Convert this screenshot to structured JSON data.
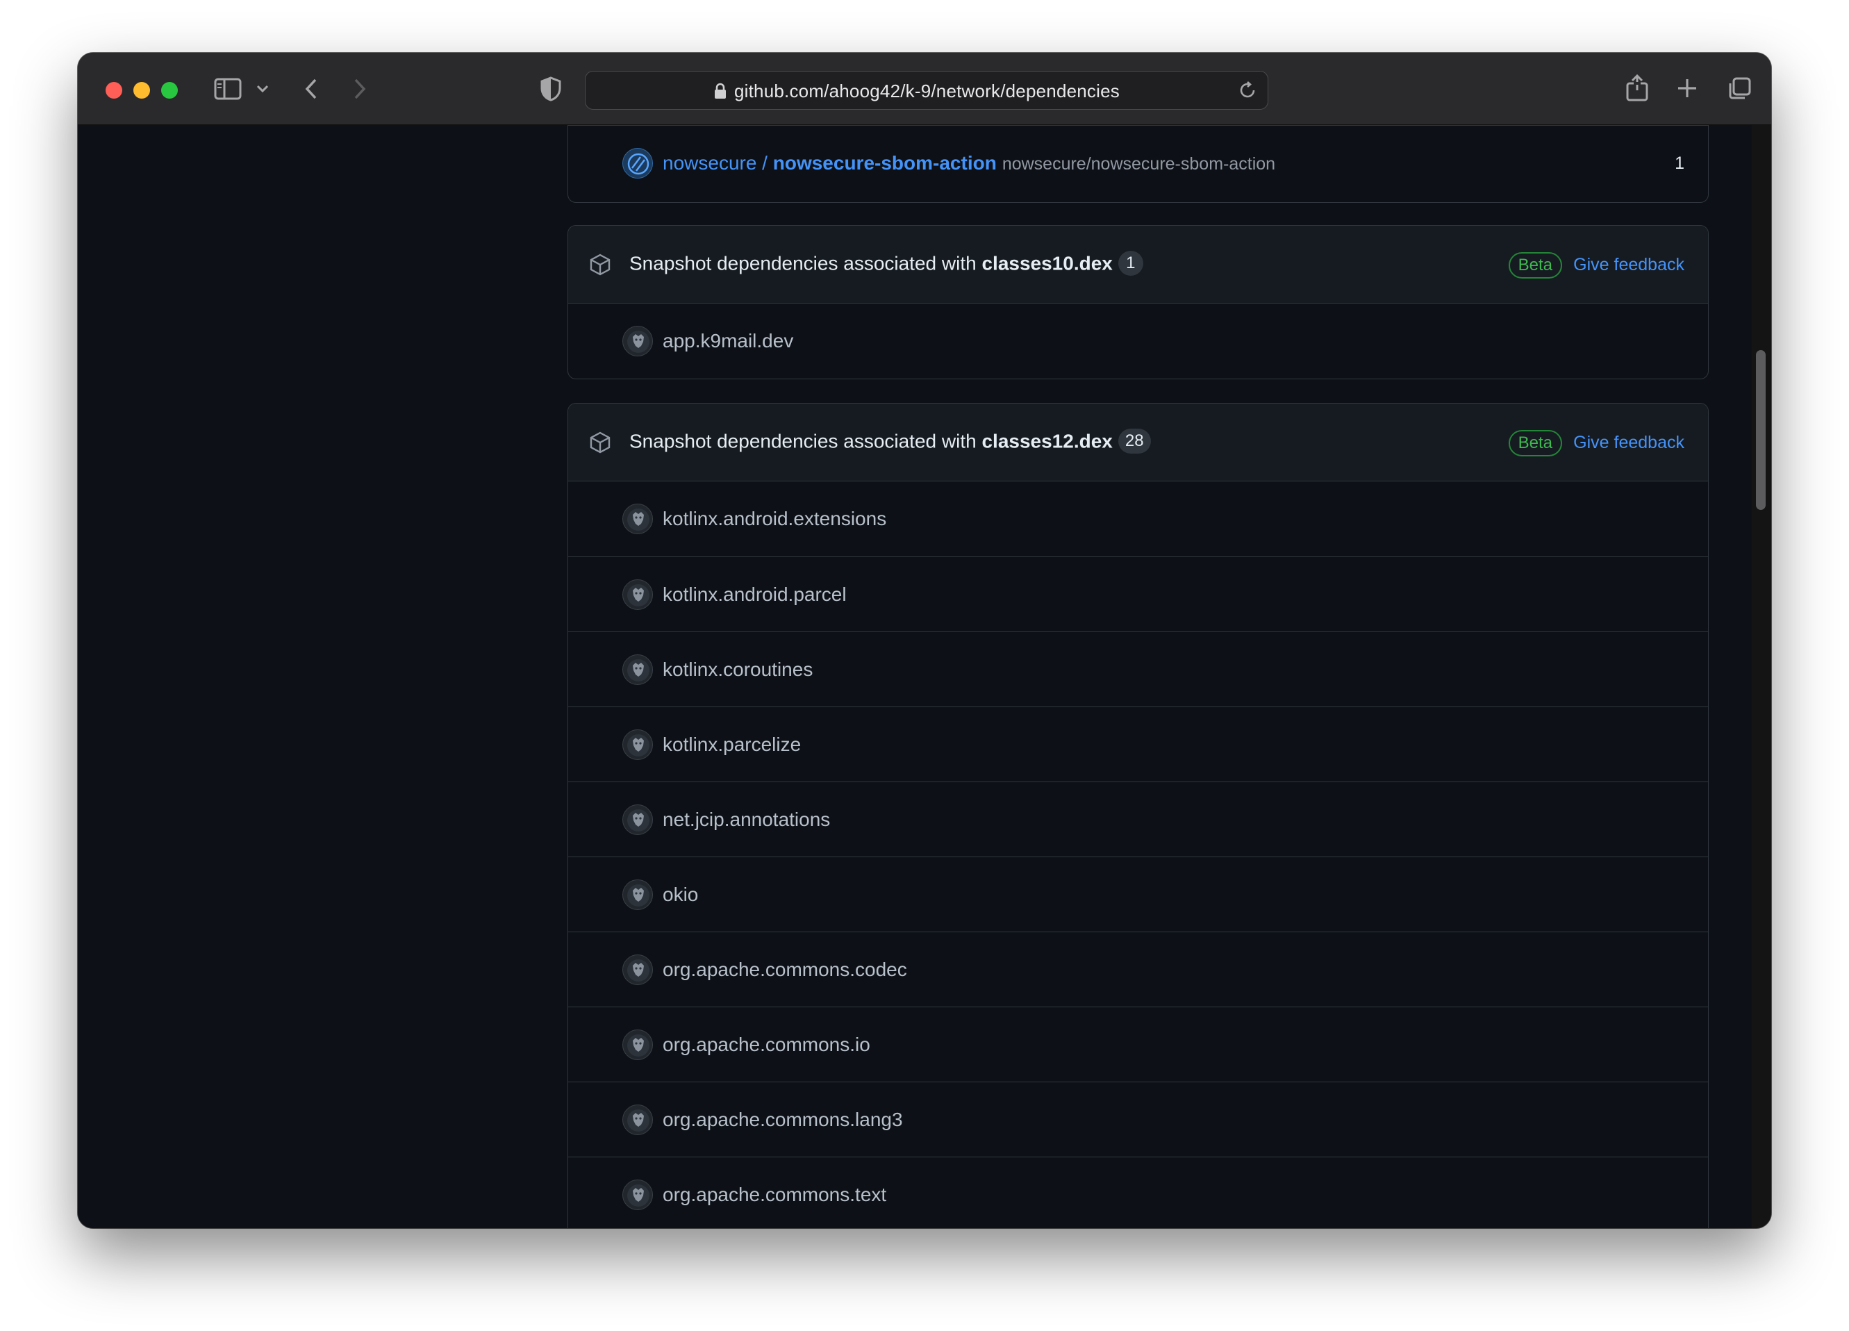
{
  "browser": {
    "url": "github.com/ahoog42/k-9/network/dependencies"
  },
  "top_box": {
    "owner": "nowsecure",
    "separator": " / ",
    "repo": "nowsecure-sbom-action",
    "subtitle": "nowsecure/nowsecure-sbom-action",
    "count": "1"
  },
  "snapshot_prefix": "Snapshot dependencies associated with ",
  "beta_label": "Beta",
  "feedback_label": "Give feedback",
  "group1": {
    "file": "classes10.dex",
    "count": "1",
    "items": [
      "app.k9mail.dev"
    ]
  },
  "group2": {
    "file": "classes12.dex",
    "count": "28",
    "items": [
      "kotlinx.android.extensions",
      "kotlinx.android.parcel",
      "kotlinx.coroutines",
      "kotlinx.parcelize",
      "net.jcip.annotations",
      "okio",
      "org.apache.commons.codec",
      "org.apache.commons.io",
      "org.apache.commons.lang3",
      "org.apache.commons.text"
    ]
  },
  "colors": {
    "background": "#0d1117",
    "header": "#161b22",
    "border": "#30363d",
    "link": "#4493f8",
    "beta": "#3fb950"
  }
}
